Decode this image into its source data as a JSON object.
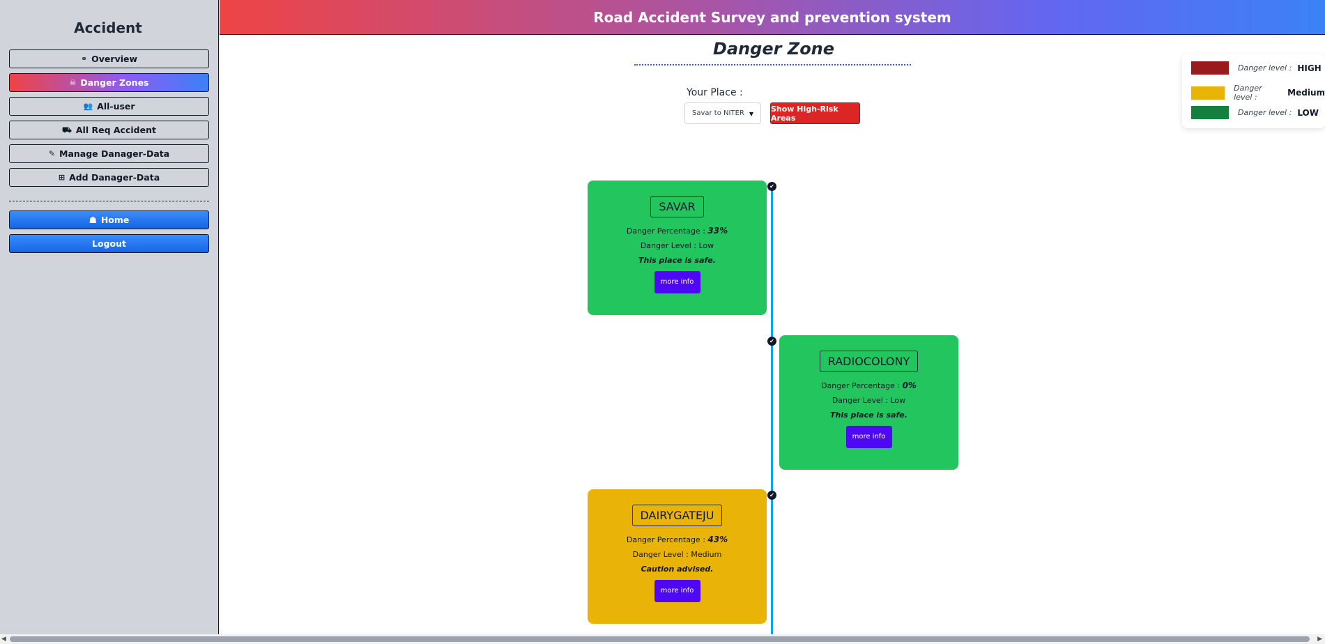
{
  "sidebar": {
    "brand": "Accident",
    "items": [
      {
        "label": "Overview",
        "icon": "binoculars-icon",
        "glyph": "⚭"
      },
      {
        "label": "Danger Zones",
        "icon": "skull-icon",
        "glyph": "☠"
      },
      {
        "label": "All-user",
        "icon": "users-icon",
        "glyph": "👥"
      },
      {
        "label": "All Req Accident",
        "icon": "car-icon",
        "glyph": "⛟"
      },
      {
        "label": "Manage Danager-Data",
        "icon": "edit-icon",
        "glyph": "✎"
      },
      {
        "label": "Add Danager-Data",
        "icon": "add-icon",
        "glyph": "⊞"
      }
    ],
    "home_label": "Home",
    "home_glyph": "☗",
    "logout_label": "Logout"
  },
  "header": {
    "title": "Road Accident Survey and prevention system"
  },
  "main": {
    "title": "Danger Zone",
    "place_label": "Your Place :",
    "place_selected": "Savar to NITER",
    "risk_button": "Show High-Risk Areas"
  },
  "legend": [
    {
      "key": "Danger level :",
      "value": "HIGH",
      "color": "#991b1b"
    },
    {
      "key": "Danger level :",
      "value": "Medium",
      "color": "#eab308"
    },
    {
      "key": "Danger level :",
      "value": "LOW",
      "color": "#15803d"
    }
  ],
  "zones": [
    {
      "name": "SAVAR",
      "pct_label": "Danger Percentage :",
      "pct": "33%",
      "level": "Danger Level : Low",
      "note": "This place is safe.",
      "button": "more info"
    },
    {
      "name": "RADIOCOLONY",
      "pct_label": "Danger Percentage :",
      "pct": "0%",
      "level": "Danger Level : Low",
      "note": "This place is safe.",
      "button": "more info"
    },
    {
      "name": "DAIRYGATEJU",
      "pct_label": "Danger Percentage :",
      "pct": "43%",
      "level": "Danger Level : Medium",
      "note": "Caution advised.",
      "button": "more info"
    }
  ],
  "colors": {
    "low": "#22c55e",
    "medium": "#eab308",
    "button": "#4f08f5",
    "timeline": "#0ea5e9"
  }
}
